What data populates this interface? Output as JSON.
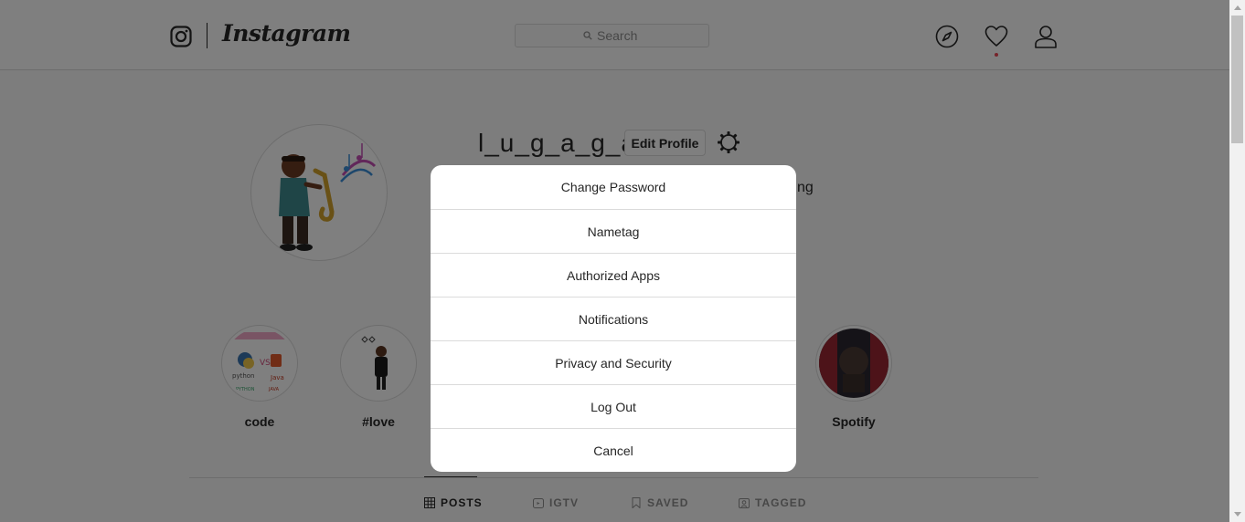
{
  "header": {
    "wordmark": "Instagram",
    "search": {
      "placeholder": "Search"
    },
    "icons": [
      "instagram-icon",
      "compass-icon",
      "heart-icon",
      "user-icon"
    ]
  },
  "profile": {
    "username": "l_u_g_a_g_a",
    "edit_label": "Edit Profile",
    "following_tail": "ng"
  },
  "highlights": [
    {
      "label": "code"
    },
    {
      "label": "#love"
    },
    {
      "label": "Spotify"
    }
  ],
  "tabs": [
    {
      "label": "POSTS",
      "icon": "grid-icon",
      "active": true
    },
    {
      "label": "IGTV",
      "icon": "igtv-icon",
      "active": false
    },
    {
      "label": "SAVED",
      "icon": "bookmark-icon",
      "active": false
    },
    {
      "label": "TAGGED",
      "icon": "tag-icon",
      "active": false
    }
  ],
  "modal": {
    "items": [
      {
        "label": "Change Password"
      },
      {
        "label": "Nametag"
      },
      {
        "label": "Authorized Apps"
      },
      {
        "label": "Notifications"
      },
      {
        "label": "Privacy and Security"
      },
      {
        "label": "Log Out"
      },
      {
        "label": "Cancel"
      }
    ]
  },
  "colors": {
    "text": "#262626",
    "muted": "#8e8e8e",
    "border": "#dbdbdb",
    "notification": "#ed4956",
    "overlay": "rgba(0,0,0,0.5)"
  }
}
